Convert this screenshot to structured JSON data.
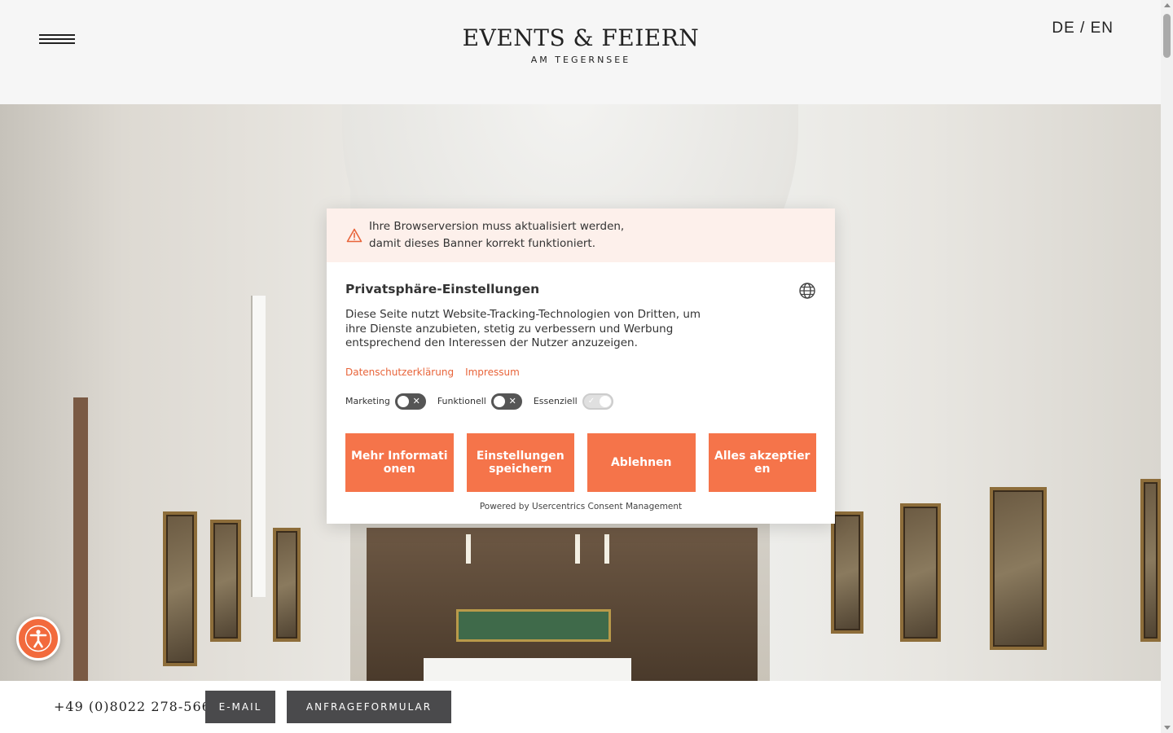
{
  "header": {
    "logo_main": "EVENTS & FEIERN",
    "logo_sub": "AM TEGERNSEE",
    "lang_de": "DE",
    "lang_sep": " / ",
    "lang_en": "EN"
  },
  "consent": {
    "warning_line1": "Ihre Browserversion muss aktualisiert werden,",
    "warning_line2": "damit dieses Banner korrekt funktioniert.",
    "title": "Privatsphäre-Einstellungen",
    "description": "Diese Seite nutzt Website-Tracking-Technologien von Dritten, um ihre Dienste anzubieten, stetig zu verbessern und Werbung entsprechend den Interessen der Nutzer anzuzeigen.",
    "links": {
      "privacy": "Datenschutzerklärung",
      "imprint": "Impressum"
    },
    "toggles": [
      {
        "label": "Marketing",
        "state": "off"
      },
      {
        "label": "Funktionell",
        "state": "off"
      },
      {
        "label": "Essenziell",
        "state": "on-disabled"
      }
    ],
    "buttons": {
      "more_info": "Mehr Informationen",
      "save": "Einstellungen speichern",
      "decline": "Ablehnen",
      "accept_all": "Alles akzeptieren"
    },
    "powered_by": "Powered by Usercentrics Consent Management"
  },
  "bottom_bar": {
    "phone": "+49 (0)8022 278-566",
    "email_label": "E-MAIL",
    "form_label": "ANFRAGEFORMULAR"
  },
  "colors": {
    "accent": "#f5744a",
    "warning_bg": "#fdf0eb",
    "dark_button": "#4a4a4c"
  },
  "icons": {
    "menu": "hamburger-menu-icon",
    "warning": "warning-triangle-icon",
    "language": "globe-icon",
    "accessibility": "accessibility-person-icon"
  }
}
